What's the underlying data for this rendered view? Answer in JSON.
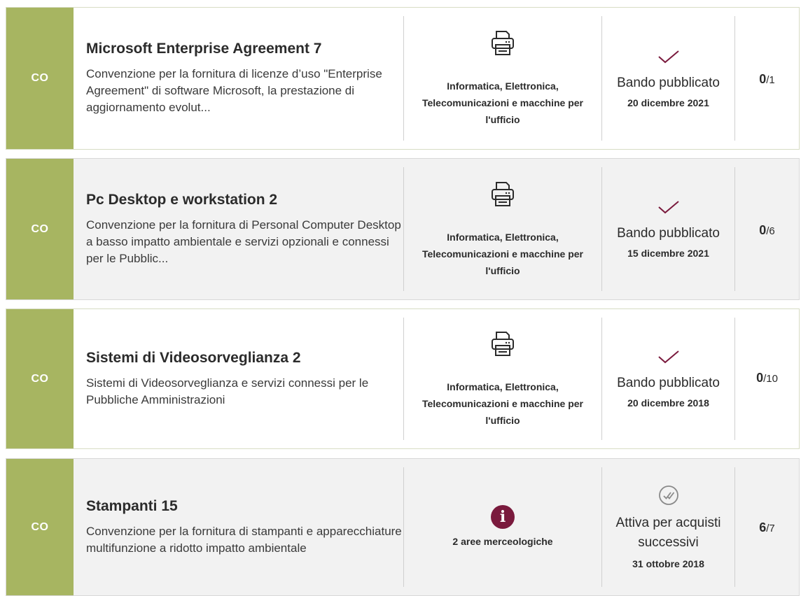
{
  "items": [
    {
      "type": "CO",
      "title": "Microsoft Enterprise Agreement 7",
      "description": "Convenzione per la fornitura di licenze d’uso \"Enterprise Agreement\" di software Microsoft, la prestazione di aggiornamento evolut...",
      "category": "Informatica, Elettronica, Telecomunicazioni e macchine per l'ufficio",
      "category_icon": "printer-icon",
      "state_icon": "check-icon",
      "state": "Bando pubblicato",
      "date": "20 dicembre 2021",
      "count": "0",
      "total": "/1"
    },
    {
      "type": "CO",
      "title": "Pc Desktop e workstation 2",
      "description": "Convenzione per la fornitura di Personal Computer Desktop a basso impatto ambientale e servizi opzionali e connessi per le Pubblic...",
      "category": "Informatica, Elettronica, Telecomunicazioni e macchine per l'ufficio",
      "category_icon": "printer-icon",
      "state_icon": "check-icon",
      "state": "Bando pubblicato",
      "date": "15 dicembre 2021",
      "count": "0",
      "total": "/6"
    },
    {
      "type": "CO",
      "title": "Sistemi di Videosorveglianza 2",
      "description": "Sistemi di Videosorveglianza e servizi connessi per le Pubbliche Amministrazioni",
      "category": "Informatica, Elettronica, Telecomunicazioni e macchine per l'ufficio",
      "category_icon": "printer-icon",
      "state_icon": "check-icon",
      "state": "Bando pubblicato",
      "date": "20 dicembre 2018",
      "count": "0",
      "total": "/10"
    },
    {
      "type": "CO",
      "title": "Stampanti 15",
      "description": "Convenzione per la fornitura di stampanti e apparecchiature multifunzione a ridotto impatto ambientale",
      "category": "2 aree merceologiche",
      "category_icon": "info-icon",
      "info_glyph": "i",
      "state_icon": "double-check-icon",
      "state": "Attiva per acquisti successivi",
      "date": "31 ottobre 2018",
      "count": "6",
      "total": "/7"
    }
  ],
  "colors": {
    "type_bar": "#a7b561",
    "accent": "#7a1a3d",
    "card_grey": "#f2f2f2",
    "card_white": "#ffffff"
  }
}
